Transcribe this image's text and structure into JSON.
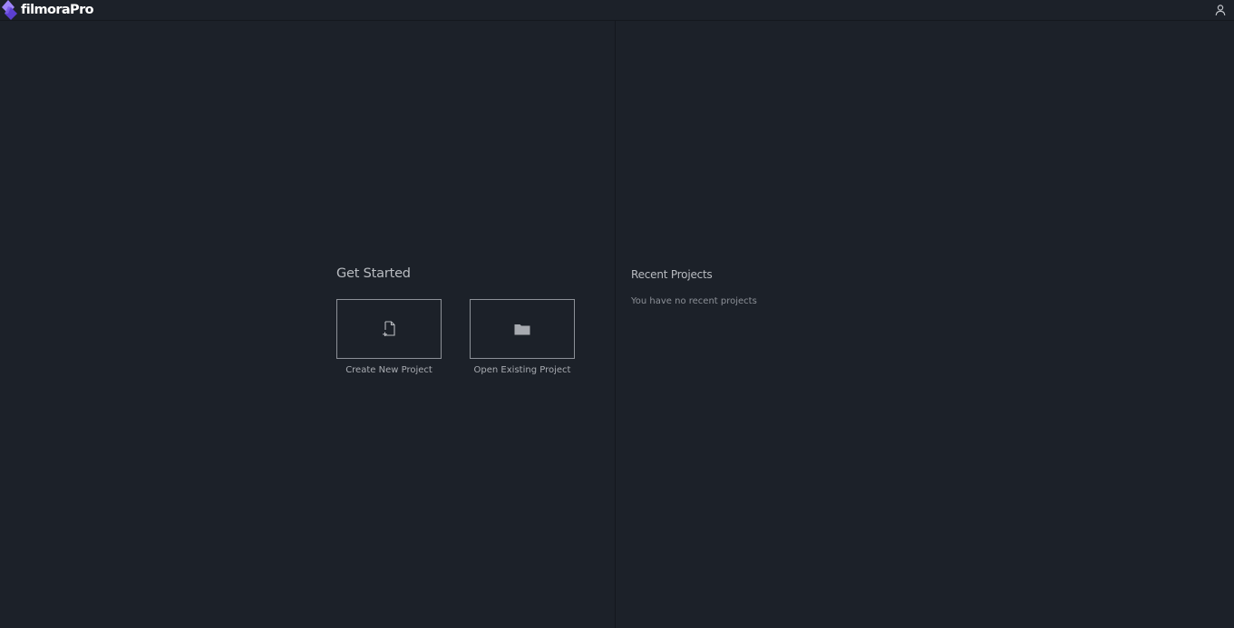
{
  "app": {
    "logo_text": "filmoraPro",
    "logo_colors": {
      "primary": "#8b6cf6",
      "secondary": "#5b3fd1"
    }
  },
  "header": {
    "account_icon": "user-icon"
  },
  "get_started": {
    "title": "Get Started",
    "actions": [
      {
        "label": "Create New Project",
        "icon": "new-file-icon"
      },
      {
        "label": "Open Existing Project",
        "icon": "folder-icon"
      }
    ]
  },
  "recent_projects": {
    "title": "Recent Projects",
    "empty_message": "You have no recent projects"
  },
  "colors": {
    "background": "#1c2129",
    "tile_border": "#8d9198",
    "heading": "#b9bcc1",
    "muted_text": "#8c9097"
  }
}
